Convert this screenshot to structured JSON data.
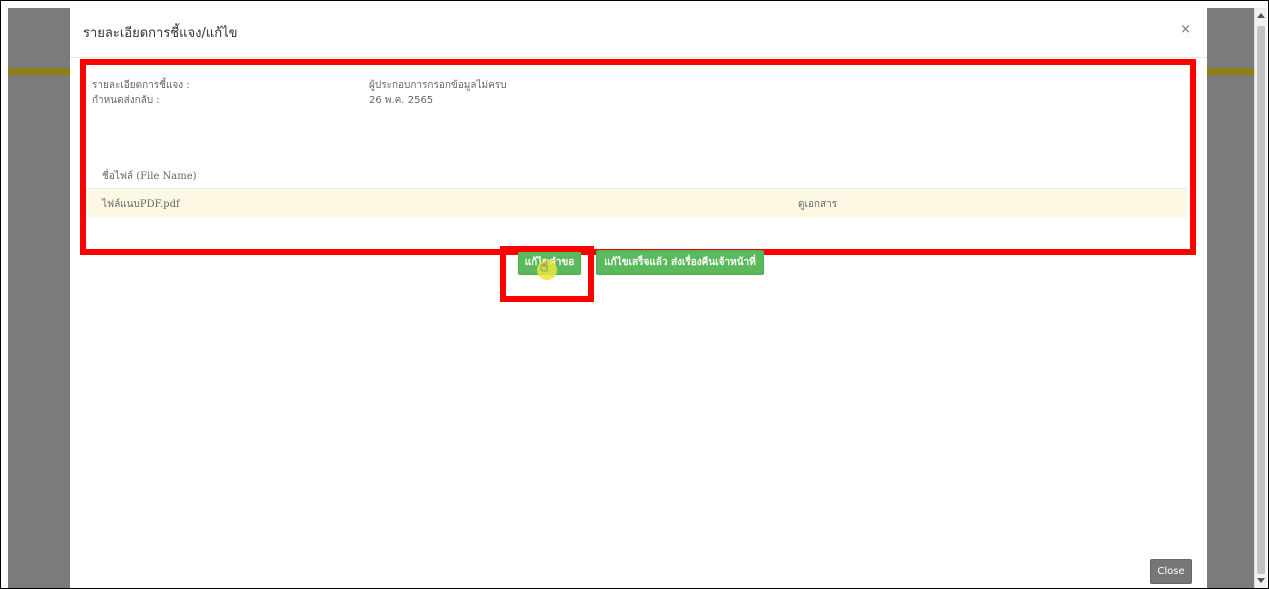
{
  "modal": {
    "title": "รายละเอียดการชี้แจง/แก้ไข",
    "close_symbol": "×",
    "details": [
      {
        "label": "รายละเอียดการชี้แจง :",
        "value": "ผู้ประกอบการกรอกข้อมูลไม่ครบ"
      },
      {
        "label": "กำหนดส่งกลับ :",
        "value": "26 พ.ค. 2565"
      }
    ],
    "files": {
      "header": "ชื่อไฟล์ (File Name)",
      "rows": [
        {
          "name": "ไฟล์แนบPDF.pdf",
          "action": "ดูเอกสาร"
        }
      ]
    },
    "buttons": {
      "edit_request": "แก้ไขคำขอ",
      "send_back": "แก้ไขเสร็จแล้ว ส่งเรื่องคืนเจ้าหน้าที่",
      "close": "Close"
    }
  },
  "colors": {
    "highlight": "#ff0000",
    "button_green": "#5cb85c",
    "row_highlight": "#fcf8e3",
    "backdrop": "#7b7b7b",
    "header_strip": "#8f7d1c"
  },
  "icons": {
    "cursor": "hand-pointer-icon"
  }
}
